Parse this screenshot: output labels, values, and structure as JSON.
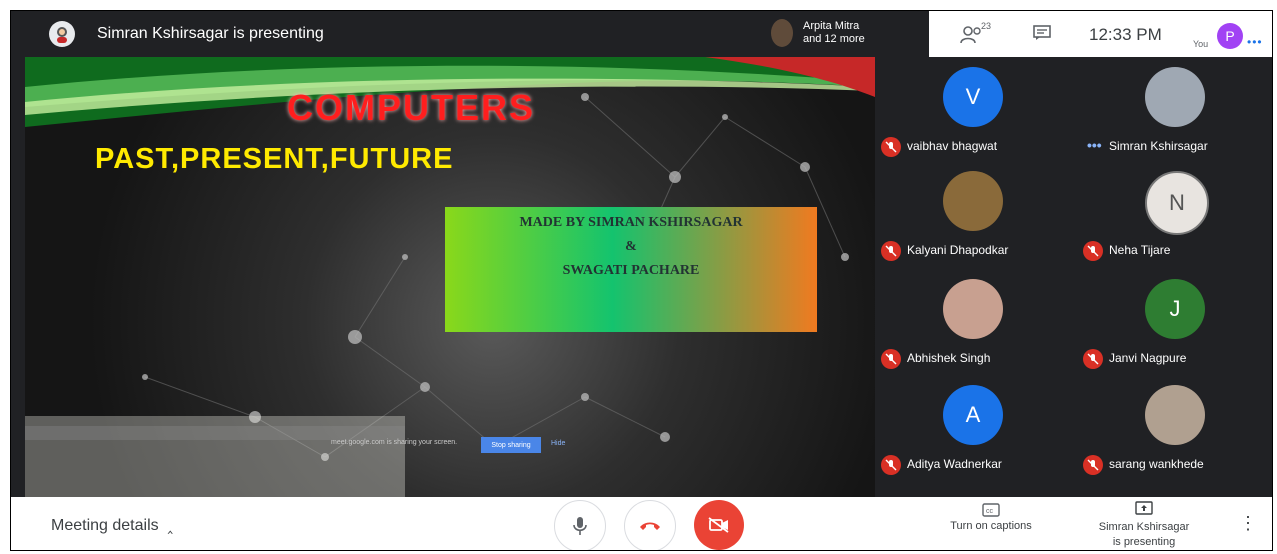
{
  "topbar": {
    "presenting_text": "Simran Kshirsagar is presenting",
    "peer_line1": "Arpita Mitra",
    "peer_line2": "and 12 more",
    "people_count": "23",
    "clock": "12:33 PM",
    "you_label": "You",
    "you_initial": "P"
  },
  "slide": {
    "title": "COMPUTERS",
    "subtitle": "PAST,PRESENT,FUTURE",
    "credit_line1": "MADE BY SIMRAN KSHIRSAGAR",
    "credit_line2": "&",
    "credit_line3": "SWAGATI PACHARE"
  },
  "participants": [
    {
      "name": "vaibhav bhagwat",
      "initial": "V",
      "color": "#1a73e8",
      "state": "muted"
    },
    {
      "name": "Simran Kshirsagar",
      "initial": "",
      "color": "#9fa8b3",
      "state": "speaking"
    },
    {
      "name": "Kalyani Dhapodkar",
      "initial": "",
      "color": "#8a6a3a",
      "state": "muted"
    },
    {
      "name": "Neha Tijare",
      "initial": "N",
      "color": "#e8e4e0",
      "state": "muted"
    },
    {
      "name": "Abhishek Singh",
      "initial": "",
      "color": "#c8a090",
      "state": "muted"
    },
    {
      "name": "Janvi Nagpure",
      "initial": "J",
      "color": "#2e7d32",
      "state": "muted"
    },
    {
      "name": "Aditya Wadnerkar",
      "initial": "A",
      "color": "#1a73e8",
      "state": "muted"
    },
    {
      "name": "sarang wankhede",
      "initial": "",
      "color": "#b0a090",
      "state": "muted"
    }
  ],
  "bottombar": {
    "meeting_details": "Meeting details",
    "captions_label": "Turn on captions",
    "present_line1": "Simran Kshirsagar",
    "present_line2": "is presenting"
  },
  "overlay": {
    "share_note": "meet.google.com is sharing your screen.",
    "stop_label": "Stop sharing",
    "hide_label": "Hide"
  },
  "colors": {
    "dark_bg": "#202124",
    "mute_red": "#d93025",
    "end_call_red": "#ea4335",
    "title_red": "#ff1e1e",
    "subtitle_yellow": "#ffea00"
  }
}
